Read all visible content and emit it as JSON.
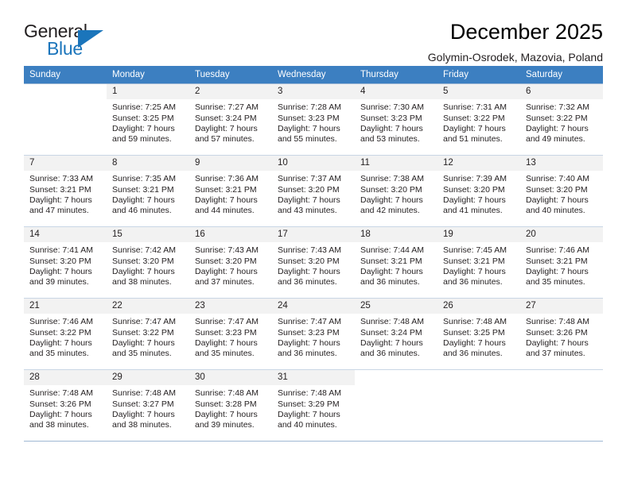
{
  "brand": {
    "word_general": "General",
    "word_blue": "Blue",
    "triangle_color": "#1b75bb"
  },
  "header": {
    "title": "December 2025",
    "subtitle": "Golymin-Osrodek, Mazovia, Poland"
  },
  "theme": {
    "header_row_bg": "#3c7fc1",
    "header_row_text": "#ffffff",
    "daynum_bg": "#f2f2f2",
    "grid_border": "#9fb8d4",
    "body_text": "#231f20"
  },
  "weekday_headers": [
    "Sunday",
    "Monday",
    "Tuesday",
    "Wednesday",
    "Thursday",
    "Friday",
    "Saturday"
  ],
  "weeks": [
    [
      {
        "day": "",
        "lines": []
      },
      {
        "day": "1",
        "lines": [
          "Sunrise: 7:25 AM",
          "Sunset: 3:25 PM",
          "Daylight: 7 hours",
          "and 59 minutes."
        ]
      },
      {
        "day": "2",
        "lines": [
          "Sunrise: 7:27 AM",
          "Sunset: 3:24 PM",
          "Daylight: 7 hours",
          "and 57 minutes."
        ]
      },
      {
        "day": "3",
        "lines": [
          "Sunrise: 7:28 AM",
          "Sunset: 3:23 PM",
          "Daylight: 7 hours",
          "and 55 minutes."
        ]
      },
      {
        "day": "4",
        "lines": [
          "Sunrise: 7:30 AM",
          "Sunset: 3:23 PM",
          "Daylight: 7 hours",
          "and 53 minutes."
        ]
      },
      {
        "day": "5",
        "lines": [
          "Sunrise: 7:31 AM",
          "Sunset: 3:22 PM",
          "Daylight: 7 hours",
          "and 51 minutes."
        ]
      },
      {
        "day": "6",
        "lines": [
          "Sunrise: 7:32 AM",
          "Sunset: 3:22 PM",
          "Daylight: 7 hours",
          "and 49 minutes."
        ]
      }
    ],
    [
      {
        "day": "7",
        "lines": [
          "Sunrise: 7:33 AM",
          "Sunset: 3:21 PM",
          "Daylight: 7 hours",
          "and 47 minutes."
        ]
      },
      {
        "day": "8",
        "lines": [
          "Sunrise: 7:35 AM",
          "Sunset: 3:21 PM",
          "Daylight: 7 hours",
          "and 46 minutes."
        ]
      },
      {
        "day": "9",
        "lines": [
          "Sunrise: 7:36 AM",
          "Sunset: 3:21 PM",
          "Daylight: 7 hours",
          "and 44 minutes."
        ]
      },
      {
        "day": "10",
        "lines": [
          "Sunrise: 7:37 AM",
          "Sunset: 3:20 PM",
          "Daylight: 7 hours",
          "and 43 minutes."
        ]
      },
      {
        "day": "11",
        "lines": [
          "Sunrise: 7:38 AM",
          "Sunset: 3:20 PM",
          "Daylight: 7 hours",
          "and 42 minutes."
        ]
      },
      {
        "day": "12",
        "lines": [
          "Sunrise: 7:39 AM",
          "Sunset: 3:20 PM",
          "Daylight: 7 hours",
          "and 41 minutes."
        ]
      },
      {
        "day": "13",
        "lines": [
          "Sunrise: 7:40 AM",
          "Sunset: 3:20 PM",
          "Daylight: 7 hours",
          "and 40 minutes."
        ]
      }
    ],
    [
      {
        "day": "14",
        "lines": [
          "Sunrise: 7:41 AM",
          "Sunset: 3:20 PM",
          "Daylight: 7 hours",
          "and 39 minutes."
        ]
      },
      {
        "day": "15",
        "lines": [
          "Sunrise: 7:42 AM",
          "Sunset: 3:20 PM",
          "Daylight: 7 hours",
          "and 38 minutes."
        ]
      },
      {
        "day": "16",
        "lines": [
          "Sunrise: 7:43 AM",
          "Sunset: 3:20 PM",
          "Daylight: 7 hours",
          "and 37 minutes."
        ]
      },
      {
        "day": "17",
        "lines": [
          "Sunrise: 7:43 AM",
          "Sunset: 3:20 PM",
          "Daylight: 7 hours",
          "and 36 minutes."
        ]
      },
      {
        "day": "18",
        "lines": [
          "Sunrise: 7:44 AM",
          "Sunset: 3:21 PM",
          "Daylight: 7 hours",
          "and 36 minutes."
        ]
      },
      {
        "day": "19",
        "lines": [
          "Sunrise: 7:45 AM",
          "Sunset: 3:21 PM",
          "Daylight: 7 hours",
          "and 36 minutes."
        ]
      },
      {
        "day": "20",
        "lines": [
          "Sunrise: 7:46 AM",
          "Sunset: 3:21 PM",
          "Daylight: 7 hours",
          "and 35 minutes."
        ]
      }
    ],
    [
      {
        "day": "21",
        "lines": [
          "Sunrise: 7:46 AM",
          "Sunset: 3:22 PM",
          "Daylight: 7 hours",
          "and 35 minutes."
        ]
      },
      {
        "day": "22",
        "lines": [
          "Sunrise: 7:47 AM",
          "Sunset: 3:22 PM",
          "Daylight: 7 hours",
          "and 35 minutes."
        ]
      },
      {
        "day": "23",
        "lines": [
          "Sunrise: 7:47 AM",
          "Sunset: 3:23 PM",
          "Daylight: 7 hours",
          "and 35 minutes."
        ]
      },
      {
        "day": "24",
        "lines": [
          "Sunrise: 7:47 AM",
          "Sunset: 3:23 PM",
          "Daylight: 7 hours",
          "and 36 minutes."
        ]
      },
      {
        "day": "25",
        "lines": [
          "Sunrise: 7:48 AM",
          "Sunset: 3:24 PM",
          "Daylight: 7 hours",
          "and 36 minutes."
        ]
      },
      {
        "day": "26",
        "lines": [
          "Sunrise: 7:48 AM",
          "Sunset: 3:25 PM",
          "Daylight: 7 hours",
          "and 36 minutes."
        ]
      },
      {
        "day": "27",
        "lines": [
          "Sunrise: 7:48 AM",
          "Sunset: 3:26 PM",
          "Daylight: 7 hours",
          "and 37 minutes."
        ]
      }
    ],
    [
      {
        "day": "28",
        "lines": [
          "Sunrise: 7:48 AM",
          "Sunset: 3:26 PM",
          "Daylight: 7 hours",
          "and 38 minutes."
        ]
      },
      {
        "day": "29",
        "lines": [
          "Sunrise: 7:48 AM",
          "Sunset: 3:27 PM",
          "Daylight: 7 hours",
          "and 38 minutes."
        ]
      },
      {
        "day": "30",
        "lines": [
          "Sunrise: 7:48 AM",
          "Sunset: 3:28 PM",
          "Daylight: 7 hours",
          "and 39 minutes."
        ]
      },
      {
        "day": "31",
        "lines": [
          "Sunrise: 7:48 AM",
          "Sunset: 3:29 PM",
          "Daylight: 7 hours",
          "and 40 minutes."
        ]
      },
      {
        "day": "",
        "lines": []
      },
      {
        "day": "",
        "lines": []
      },
      {
        "day": "",
        "lines": []
      }
    ]
  ]
}
